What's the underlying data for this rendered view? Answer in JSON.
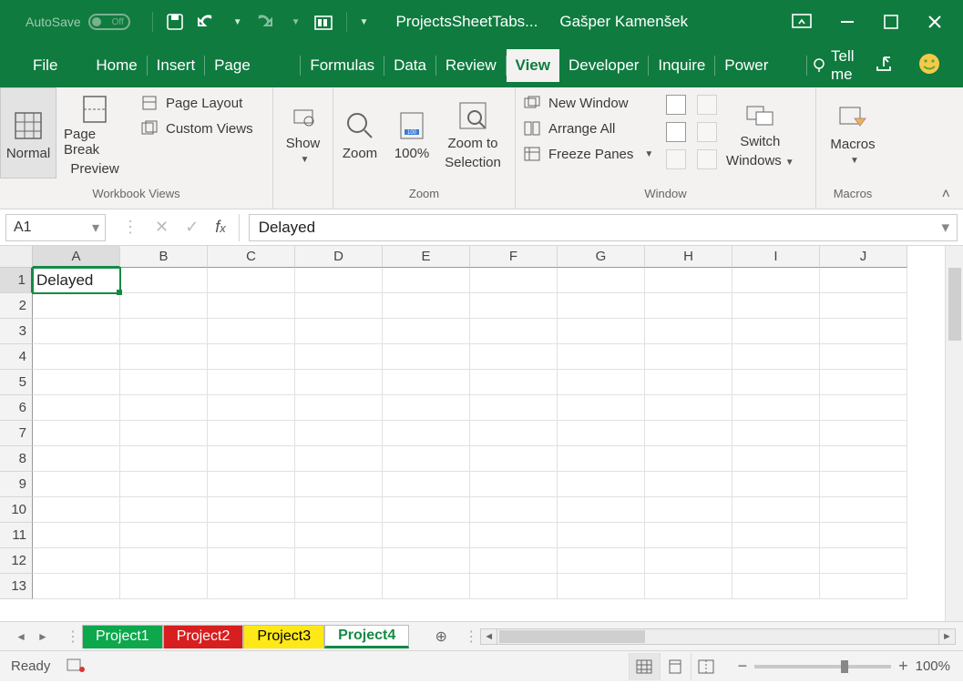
{
  "title": {
    "autosave_label": "AutoSave",
    "autosave_off": "Off",
    "filename": "ProjectsSheetTabs...",
    "user": "Gašper Kamenšek"
  },
  "tabs": {
    "file": "File",
    "list": [
      "Home",
      "Insert",
      "Page Layout",
      "Formulas",
      "Data",
      "Review",
      "View",
      "Developer",
      "Inquire",
      "Power Pivot"
    ],
    "active": "View",
    "tellme": "Tell me"
  },
  "ribbon": {
    "workbook_views": {
      "normal": "Normal",
      "pagebreak_l1": "Page Break",
      "pagebreak_l2": "Preview",
      "page_layout": "Page Layout",
      "custom_views": "Custom Views",
      "group": "Workbook Views"
    },
    "show": {
      "label": "Show",
      "group": ""
    },
    "zoom": {
      "zoom": "Zoom",
      "hundred": "100%",
      "zoom_sel_l1": "Zoom to",
      "zoom_sel_l2": "Selection",
      "group": "Zoom"
    },
    "window": {
      "new_window": "New Window",
      "arrange_all": "Arrange All",
      "freeze": "Freeze Panes",
      "switch_l1": "Switch",
      "switch_l2": "Windows",
      "group": "Window"
    },
    "macros": {
      "label": "Macros",
      "group": "Macros"
    }
  },
  "formula": {
    "name": "A1",
    "value": "Delayed"
  },
  "grid": {
    "columns": [
      "A",
      "B",
      "C",
      "D",
      "E",
      "F",
      "G",
      "H",
      "I",
      "J"
    ],
    "rows": [
      "1",
      "2",
      "3",
      "4",
      "5",
      "6",
      "7",
      "8",
      "9",
      "10",
      "11",
      "12",
      "13"
    ],
    "cell_A1": "Delayed"
  },
  "sheets": {
    "tabs": [
      {
        "label": "Project1",
        "cls": "green"
      },
      {
        "label": "Project2",
        "cls": "red"
      },
      {
        "label": "Project3",
        "cls": "yellow"
      },
      {
        "label": "Project4",
        "cls": "active"
      }
    ]
  },
  "status": {
    "ready": "Ready",
    "zoom": "100%"
  }
}
